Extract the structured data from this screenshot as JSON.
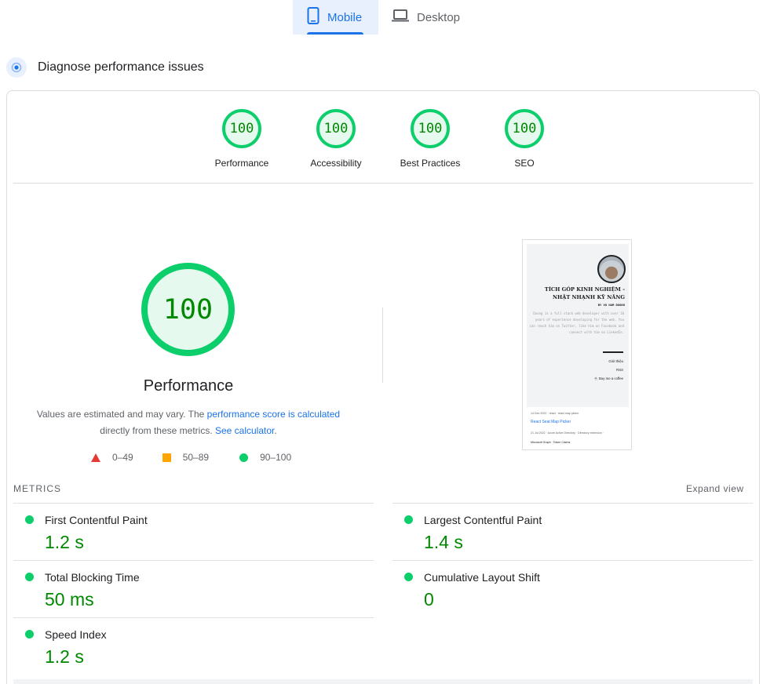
{
  "device_tabs": [
    {
      "label": "Mobile",
      "icon": "phone-icon",
      "selected": true
    },
    {
      "label": "Desktop",
      "icon": "laptop-icon",
      "selected": false
    }
  ],
  "diagnose": {
    "title": "Diagnose performance issues",
    "icon": "lighthouse-dot-icon"
  },
  "scores": [
    {
      "value": "100",
      "label": "Performance"
    },
    {
      "value": "100",
      "label": "Accessibility"
    },
    {
      "value": "100",
      "label": "Best Practices"
    },
    {
      "value": "100",
      "label": "SEO"
    }
  ],
  "performance": {
    "score": "100",
    "title": "Performance",
    "desc_text1": "Values are estimated and may vary. The ",
    "desc_link1": "performance score is calculated",
    "desc_text2": "directly from these metrics. ",
    "desc_link2": "See calculator",
    "desc_text3": "."
  },
  "legend": [
    {
      "range": "0–49",
      "shape": "triangle",
      "color": "#e53935"
    },
    {
      "range": "50–89",
      "shape": "square",
      "color": "#ffa400"
    },
    {
      "range": "90–100",
      "shape": "circle",
      "color": "#0cce6b"
    }
  ],
  "thumbnail": {
    "title_line1": "TÍCH GÓP KINH NGHIỆM -",
    "title_line2": "NHẶT NHẠNH KỸ NĂNG",
    "byline": "BY VO NAM DUONG",
    "bio": "Duong is a full stack web developer with over 10 years of experience developing for the web. You can reach him on Twitter, like him on Facebook and connect with him on LinkedIn.",
    "links": [
      "Giới thiệu",
      "RSS",
      "☕ Buy me a coffee"
    ],
    "post1_meta": "14 Dec 2022 · react · react map picker",
    "post1_title": "React Seat Map Picker",
    "post2_meta": "21 Jul 2022 · Azure Active Directory · Directory extension ·",
    "post2_meta2": "Microsoft Graph · Token Claims"
  },
  "metrics": {
    "header": "METRICS",
    "expand_label": "Expand view",
    "items": [
      {
        "label": "First Contentful Paint",
        "value": "1.2 s",
        "status_color": "#0cce6b"
      },
      {
        "label": "Largest Contentful Paint",
        "value": "1.4 s",
        "status_color": "#0cce6b"
      },
      {
        "label": "Total Blocking Time",
        "value": "50 ms",
        "status_color": "#0cce6b"
      },
      {
        "label": "Cumulative Layout Shift",
        "value": "0",
        "status_color": "#0cce6b"
      },
      {
        "label": "Speed Index",
        "value": "1.2 s",
        "status_color": "#0cce6b"
      }
    ]
  },
  "colors": {
    "accent": "#1a73e8",
    "pass": "#0cce6b",
    "pass_text": "#008800"
  }
}
